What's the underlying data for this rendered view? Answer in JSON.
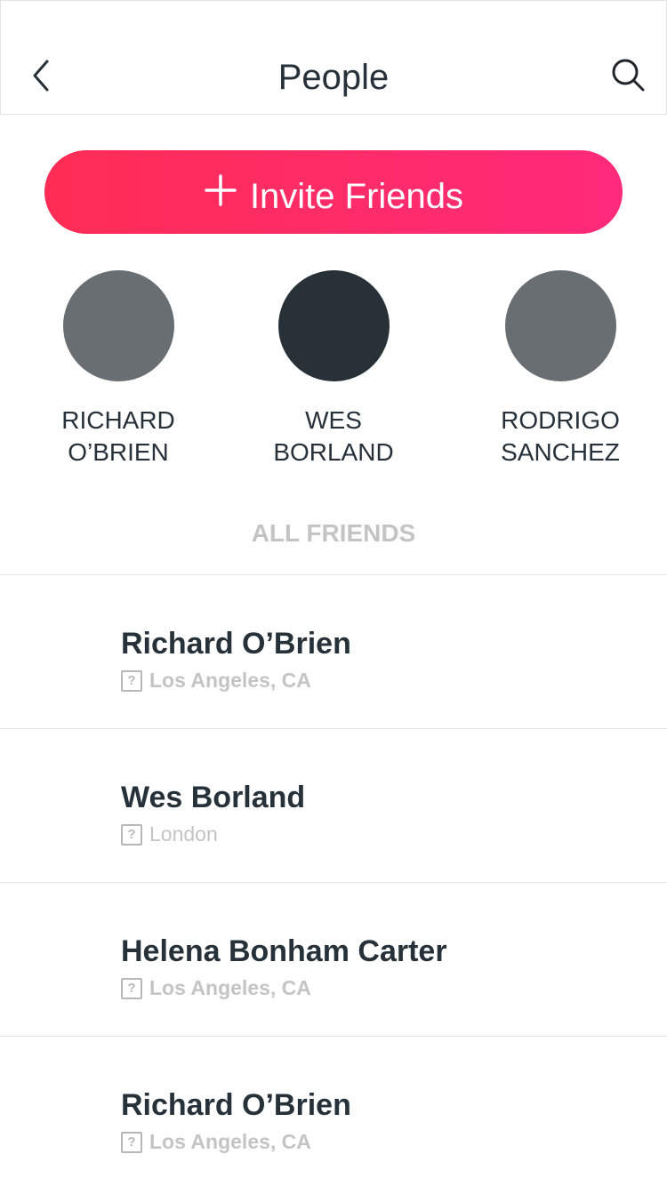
{
  "header": {
    "title": "People",
    "back_icon": "chevron-left-icon",
    "search_icon": "search-icon"
  },
  "invite": {
    "label": "Invite Friends",
    "icon": "plus-icon",
    "gradient_start": "#ff2d55",
    "gradient_end": "#ff2a7a"
  },
  "featured": [
    {
      "first": "RICHARD",
      "last": "O’BRIEN",
      "avatar_color": "#686e72"
    },
    {
      "first": "WES",
      "last": "BORLAND",
      "avatar_color": "#283138"
    },
    {
      "first": "RODRIGO",
      "last": "SANCHEZ",
      "avatar_color": "#686e72"
    }
  ],
  "section_label": "ALL FRIENDS",
  "friends": [
    {
      "name": "Richard O’Brien",
      "location": "Los Angeles, CA"
    },
    {
      "name": "Wes Borland",
      "location": "London"
    },
    {
      "name": "Helena Bonham Carter",
      "location": "Los Angeles, CA"
    },
    {
      "name": "Richard O’Brien",
      "location": "Los Angeles, CA"
    }
  ],
  "colors": {
    "text_dark": "#27313a",
    "text_muted": "#c4c4c4",
    "divider": "#e3e3e3"
  }
}
